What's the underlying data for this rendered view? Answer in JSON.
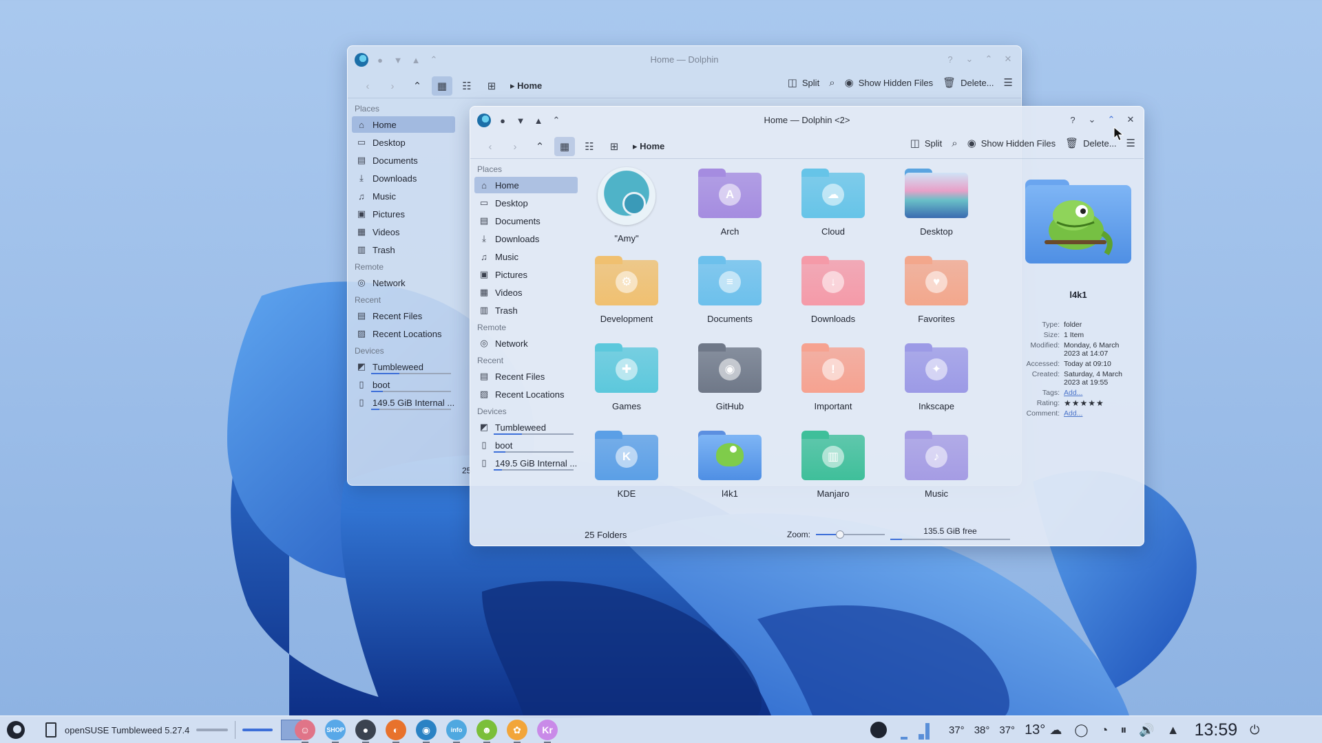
{
  "colors": {
    "accent": "#3d6fd8",
    "selection": "#7b98cf",
    "panel": "#d6e2f2"
  },
  "back_window": {
    "title": "Home — Dolphin",
    "crumb": "Home",
    "split_label": "Split",
    "hidden_label": "Show Hidden Files",
    "delete_label": "Delete...",
    "status_fragment": "25"
  },
  "front_window": {
    "title": "Home — Dolphin <2>",
    "crumb": "Home",
    "split_label": "Split",
    "hidden_label": "Show Hidden Files",
    "delete_label": "Delete..."
  },
  "sidebar": {
    "places_label": "Places",
    "places": [
      {
        "label": "Home",
        "icon": "home-icon"
      },
      {
        "label": "Desktop",
        "icon": "desktop-icon"
      },
      {
        "label": "Documents",
        "icon": "documents-icon"
      },
      {
        "label": "Downloads",
        "icon": "downloads-icon"
      },
      {
        "label": "Music",
        "icon": "music-icon"
      },
      {
        "label": "Pictures",
        "icon": "pictures-icon"
      },
      {
        "label": "Videos",
        "icon": "videos-icon"
      },
      {
        "label": "Trash",
        "icon": "trash-icon"
      }
    ],
    "remote_label": "Remote",
    "remote": [
      {
        "label": "Network",
        "icon": "network-icon"
      }
    ],
    "recent_label": "Recent",
    "recent": [
      {
        "label": "Recent Files",
        "icon": "recent-files-icon"
      },
      {
        "label": "Recent Locations",
        "icon": "recent-locations-icon"
      }
    ],
    "devices_label": "Devices",
    "devices": [
      {
        "label": "Tumbleweed",
        "usage": 0.35
      },
      {
        "label": "boot",
        "usage": 0.15
      },
      {
        "label": "149.5 GiB Internal ...",
        "usage": 0.1
      }
    ]
  },
  "files": [
    {
      "label": "\"Amy\"",
      "color": "#4fb3c8",
      "emblem": ""
    },
    {
      "label": "Arch",
      "color": "#a58ce0",
      "emblem": "A"
    },
    {
      "label": "Cloud",
      "color": "#66c4e8",
      "emblem": "☁"
    },
    {
      "label": "Desktop",
      "color": "#5aa4e0",
      "emblem": ""
    },
    {
      "label": "Development",
      "color": "#f0c070",
      "emblem": "⚙"
    },
    {
      "label": "Documents",
      "color": "#6cc0ec",
      "emblem": "≡"
    },
    {
      "label": "Downloads",
      "color": "#f59aa8",
      "emblem": "↓"
    },
    {
      "label": "Favorites",
      "color": "#f3a78c",
      "emblem": "♥"
    },
    {
      "label": "Games",
      "color": "#5cc8dc",
      "emblem": "✚"
    },
    {
      "label": "GitHub",
      "color": "#6f7888",
      "emblem": "◉"
    },
    {
      "label": "Important",
      "color": "#f6a290",
      "emblem": "!"
    },
    {
      "label": "Inkscape",
      "color": "#9c9ae6",
      "emblem": "✦"
    },
    {
      "label": "KDE",
      "color": "#5b9fe6",
      "emblem": "K"
    },
    {
      "label": "l4k1",
      "color": "#5c8fe0",
      "emblem": ""
    },
    {
      "label": "Manjaro",
      "color": "#3fbf9a",
      "emblem": "▥"
    },
    {
      "label": "Music",
      "color": "#a59ce4",
      "emblem": "♪"
    }
  ],
  "info": {
    "name": "l4k1",
    "rows": [
      {
        "k": "Type:",
        "v": "folder"
      },
      {
        "k": "Size:",
        "v": "1 Item"
      },
      {
        "k": "Modified:",
        "v": "Monday, 6 March 2023 at 14:07"
      },
      {
        "k": "Accessed:",
        "v": "Today at 09:10"
      },
      {
        "k": "Created:",
        "v": "Saturday, 4 March 2023 at 19:55"
      },
      {
        "k": "Tags:",
        "v": "Add..."
      },
      {
        "k": "Rating:",
        "v": "★★★★★"
      },
      {
        "k": "Comment:",
        "v": "Add..."
      }
    ]
  },
  "status": {
    "count": "25 Folders",
    "zoom_label": "Zoom:",
    "zoom": 0.35,
    "free": "135.5 GiB free",
    "used": 0.1
  },
  "taskbar": {
    "task_title": "openSUSE Tumbleweed 5.27.4",
    "temps": [
      "37°",
      "38°",
      "37°"
    ],
    "weather": "13°",
    "clock": "13:59",
    "apps": [
      {
        "name": "sticker-app",
        "color": "#e07488",
        "glyph": "☺"
      },
      {
        "name": "shop-app",
        "color": "#58a8e8",
        "glyph": "SHOP"
      },
      {
        "name": "settings-app",
        "color": "#3b4350",
        "glyph": "●"
      },
      {
        "name": "firefox-app",
        "color": "#e8722c",
        "glyph": "◐"
      },
      {
        "name": "dolphin-app",
        "color": "#2a82c4",
        "glyph": "◉"
      },
      {
        "name": "info-app",
        "color": "#4fa8e0",
        "glyph": "info"
      },
      {
        "name": "gecko-app",
        "color": "#7bbf3a",
        "glyph": "☻"
      },
      {
        "name": "photos-app",
        "color": "#f2a53a",
        "glyph": "✿"
      },
      {
        "name": "krita-app",
        "color": "#c98ae8",
        "glyph": "Kr"
      }
    ]
  }
}
